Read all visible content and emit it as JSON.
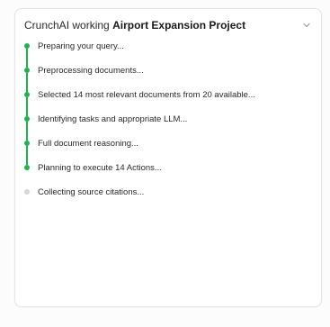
{
  "header": {
    "prefix": "CrunchAI working",
    "project": "Airport Expansion Project"
  },
  "colors": {
    "done": "#22b14c",
    "pending": "#d6d6d6"
  },
  "steps": [
    {
      "label": "Preparing your query...",
      "status": "done"
    },
    {
      "label": "Preprocessing documents...",
      "status": "done"
    },
    {
      "label": "Selected 14 most relevant documents from 20 available...",
      "status": "done"
    },
    {
      "label": "Identifying tasks and appropriate LLM...",
      "status": "done"
    },
    {
      "label": "Full document reasoning...",
      "status": "done"
    },
    {
      "label": "Planning to execute 14 Actions...",
      "status": "done"
    },
    {
      "label": "Collecting source citations...",
      "status": "pending"
    }
  ]
}
